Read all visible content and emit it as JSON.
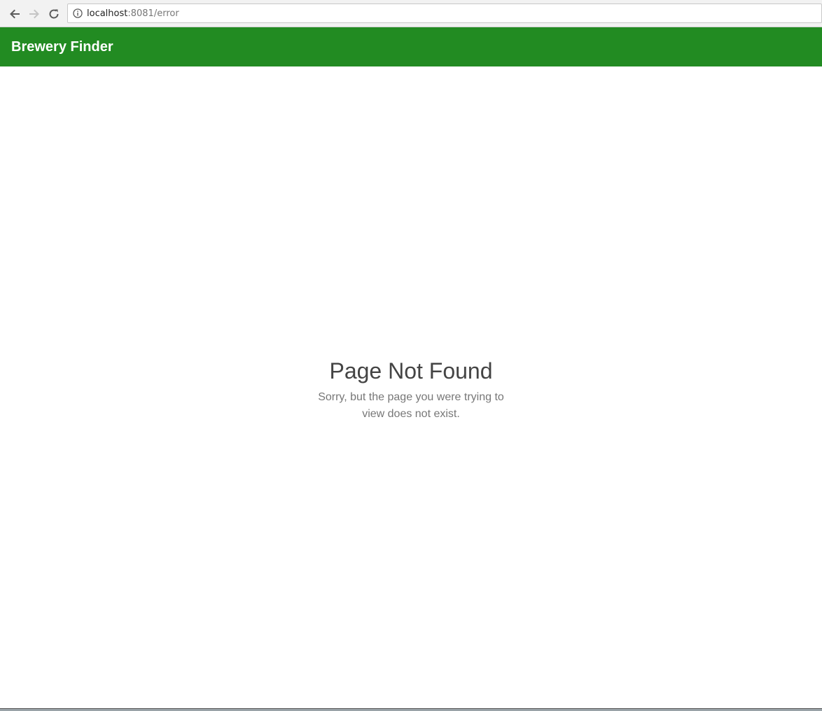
{
  "browser": {
    "url_host": "localhost",
    "url_rest": ":8081/error",
    "back_icon": "arrow-left-icon",
    "forward_icon": "arrow-right-icon",
    "reload_icon": "reload-icon",
    "info_icon": "info-icon"
  },
  "header": {
    "brand": "Brewery Finder",
    "color": "#228b22"
  },
  "error": {
    "title": "Page Not Found",
    "message": "Sorry, but the page you were trying to view does not exist."
  }
}
